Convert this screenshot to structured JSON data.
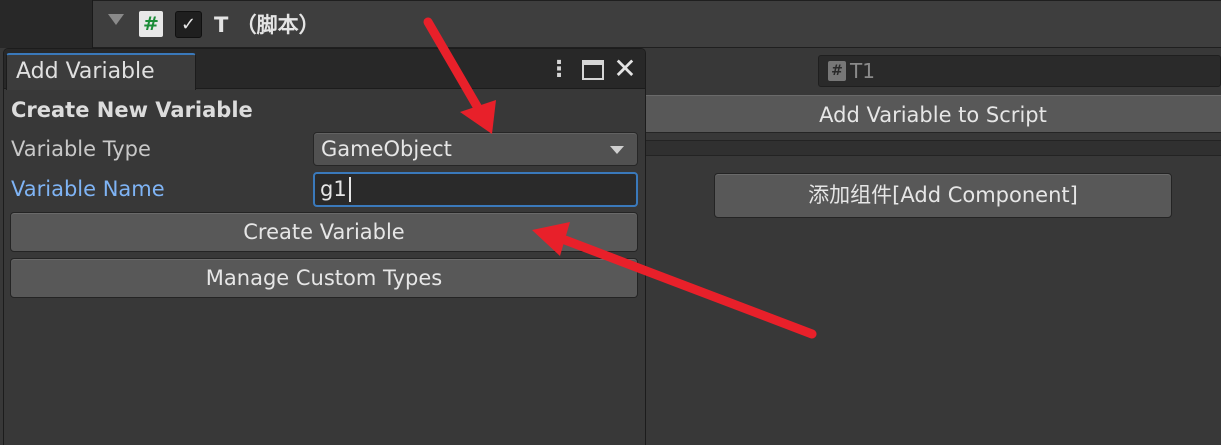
{
  "component_header": {
    "script_icon_glyph": "#",
    "checkbox_glyph": "✓",
    "title": "T  （脚本）"
  },
  "script_field": {
    "icon_glyph": "#",
    "value": "T1"
  },
  "inspector": {
    "add_variable_to_script_label": "Add Variable to Script",
    "add_component_label": "添加组件[Add Component]"
  },
  "popup": {
    "tab_title": "Add Variable",
    "menu_glyph": "⋮",
    "close_glyph": "✕",
    "section_title": "Create New Variable",
    "variable_type_label": "Variable Type",
    "variable_type_value": "GameObject",
    "variable_name_label": "Variable Name",
    "variable_name_value": "g1",
    "create_button_label": "Create Variable",
    "manage_button_label": "Manage Custom Types"
  },
  "icons": [
    "foldout-arrow-icon",
    "script-icon",
    "checkbox-icon",
    "menu-icon",
    "maximize-icon",
    "close-icon",
    "dropdown-arrow-icon"
  ],
  "colors": {
    "accent": "#3a79bb",
    "label_focus": "#7fb4f5",
    "annotation_arrow": "#e8202a",
    "script_icon_green": "#1c8c38"
  }
}
